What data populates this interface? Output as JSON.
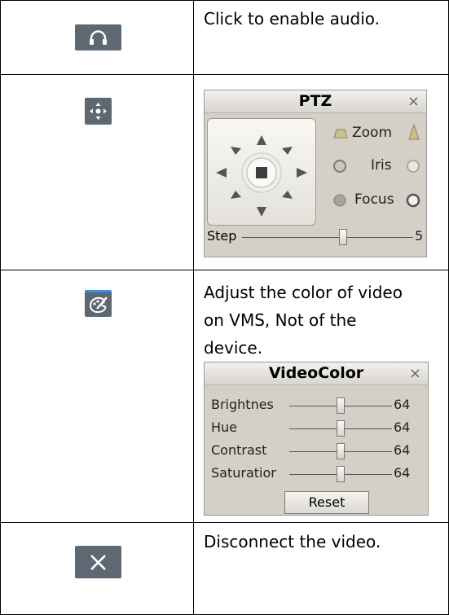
{
  "rows": [
    {
      "icon": "headphones-icon",
      "description": "Click to enable audio."
    },
    {
      "icon": "ptz-move-icon"
    },
    {
      "icon": "palette-icon",
      "description_lines": [
        "Adjust the color of video",
        "on VMS, Not of the",
        "device."
      ]
    },
    {
      "icon": "close-icon",
      "description": "Disconnect the video."
    }
  ],
  "ptz_panel": {
    "title": "PTZ",
    "close": "×",
    "zoom_label": "Zoom",
    "iris_label": "Iris",
    "focus_label": "Focus",
    "step_label": "Step",
    "step_value": "5"
  },
  "videocolor_panel": {
    "title": "VideoColor",
    "close": "×",
    "sliders": [
      {
        "label": "Brightnes",
        "value": "64"
      },
      {
        "label": "Hue",
        "value": "64"
      },
      {
        "label": "Contrast",
        "value": "64"
      },
      {
        "label": "Saturatior",
        "value": "64"
      }
    ],
    "reset_label": "Reset"
  },
  "colors": {
    "icon_bg": "#5d6873",
    "panel_bg": "#d4d0c8"
  }
}
